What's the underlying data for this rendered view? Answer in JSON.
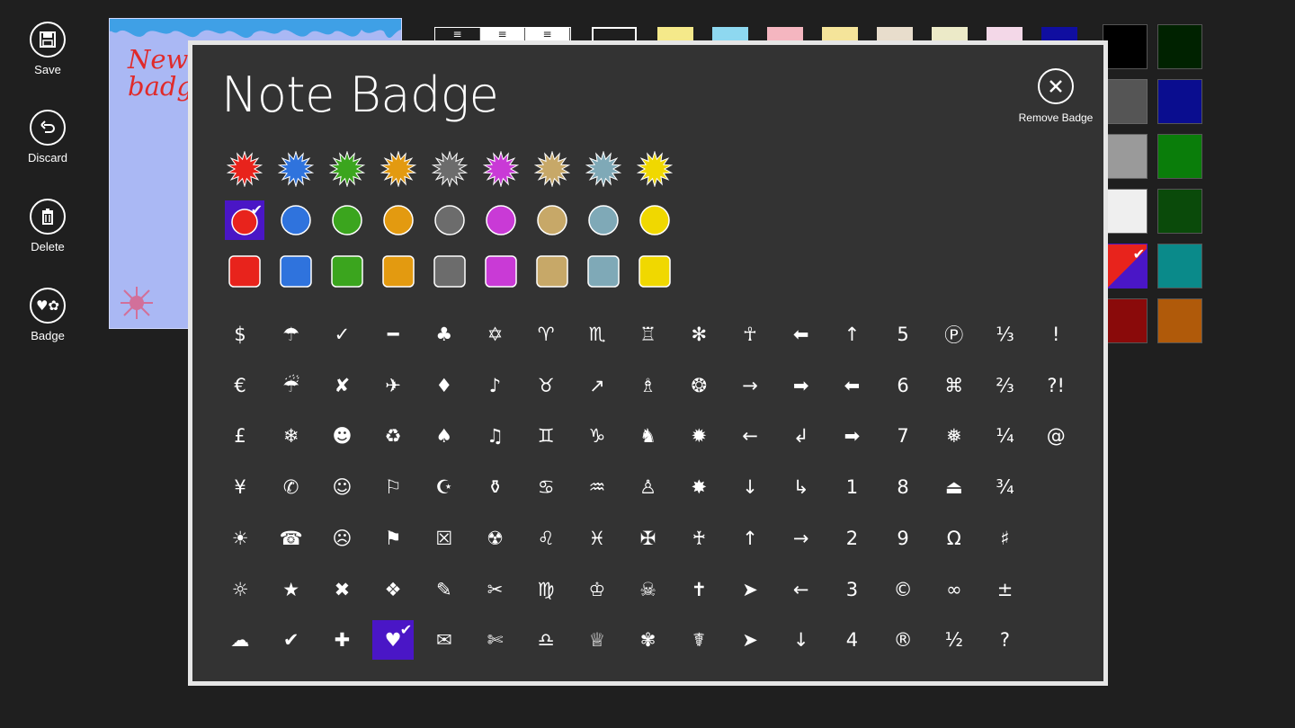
{
  "appbar": {
    "buttons": [
      {
        "label": "Save",
        "icon": "save-icon"
      },
      {
        "label": "Discard",
        "icon": "undo-icon"
      },
      {
        "label": "Delete",
        "icon": "trash-icon"
      },
      {
        "label": "Badge",
        "icon": "badge-icon"
      }
    ]
  },
  "note": {
    "text_line1": "New",
    "text_line2": "badg"
  },
  "dialog": {
    "title": "Note Badge",
    "remove_label": "Remove Badge",
    "badge_colors": [
      "#e8231c",
      "#2f73dd",
      "#3ba51e",
      "#e39a10",
      "#6c6c6c",
      "#c93ad6",
      "#c7a868",
      "#7fa9b7",
      "#f0d800"
    ],
    "shape_rows": [
      "starburst",
      "circle",
      "square"
    ],
    "selected_shape": {
      "row": 1,
      "col": 0
    },
    "symbols": [
      [
        "$",
        "☂",
        "✓",
        "━",
        "♣",
        "✡",
        "♈",
        "♏",
        "♖",
        "✻",
        "☥",
        "⬅",
        "↑",
        "5",
        "Ⓟ",
        "⅓",
        "!"
      ],
      [
        "€",
        "☔",
        "✘",
        "✈",
        "♦",
        "♪",
        "♉",
        "↗",
        "♗",
        "❂",
        "→",
        "➡",
        "⬅",
        "6",
        "⌘",
        "⅔",
        "?!"
      ],
      [
        "£",
        "❄",
        "☻",
        "♻",
        "♠",
        "♫",
        "♊",
        "♑",
        "♞",
        "✹",
        "←",
        "↲",
        "➡",
        "7",
        "❅",
        "¼",
        "@"
      ],
      [
        "¥",
        "✆",
        "☺",
        "⚐",
        "☪",
        "⚱",
        "♋",
        "♒",
        "♙",
        "✸",
        "↓",
        "↳",
        "1",
        "8",
        "⏏",
        "¾",
        ""
      ],
      [
        "☀",
        "☎",
        "☹",
        "⚑",
        "☒",
        "☢",
        "♌",
        "♓",
        "✠",
        "♰",
        "↑",
        "→",
        "2",
        "9",
        "Ω",
        "♯",
        ""
      ],
      [
        "☼",
        "★",
        "✖",
        "❖",
        "✎",
        "✂",
        "♍",
        "♔",
        "☠",
        "✝",
        "➤",
        "←",
        "3",
        "©",
        "∞",
        "±",
        ""
      ],
      [
        "☁",
        "✔",
        "✚",
        "♥",
        "✉",
        "✄",
        "♎",
        "♕",
        "✾",
        "☤",
        "➤",
        "↓",
        "4",
        "®",
        "½",
        "?",
        ""
      ]
    ],
    "selected_symbol": {
      "row": 6,
      "col": 3
    }
  },
  "swatches": [
    {
      "color": "#000000",
      "border": "#555"
    },
    {
      "color": "#002200",
      "border": "#555"
    },
    {
      "color": "#555555",
      "border": "#666"
    },
    {
      "color": "#0a0d8f",
      "border": "#555"
    },
    {
      "color": "#9a9a9a",
      "border": "#666"
    },
    {
      "color": "#0a7d0a",
      "border": "#555"
    },
    {
      "color": "#efefef",
      "border": "#666"
    },
    {
      "color": "#0a4a0a",
      "border": "#555"
    },
    {
      "color": "#e8231c",
      "border": "#4a16c6"
    },
    {
      "color": "#0a8a8a",
      "border": "#555"
    },
    {
      "color": "#8a0a0a",
      "border": "#555"
    },
    {
      "color": "#b05a0a",
      "border": "#555"
    }
  ],
  "paper_colors": [
    "#f5e98a",
    "#8ed8f0",
    "#f5b6c0",
    "#f5e49a",
    "#e8ddcc",
    "#eceac8",
    "#f4d8e8",
    "#100ea0"
  ]
}
